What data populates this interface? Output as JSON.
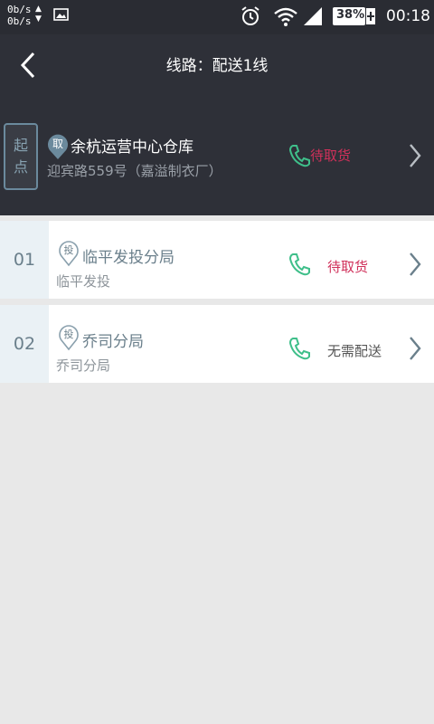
{
  "statusbar": {
    "net_up": "0b/s",
    "net_down": "0b/s",
    "battery": "38%",
    "time": "00:18",
    "icons": [
      "gallery-icon",
      "alarm-icon",
      "wifi-icon",
      "signal-icon",
      "battery-icon"
    ]
  },
  "header": {
    "title": "线路：配送1线",
    "back_icon": "chevron-left-icon"
  },
  "start": {
    "badge_line1": "起",
    "badge_line2": "点",
    "pin_label": "取",
    "name": "余杭运营中心仓库",
    "address": "迎宾路559号（嘉溢制衣厂）",
    "status": "待取货",
    "status_color": "#d0305a"
  },
  "stops": [
    {
      "index": "01",
      "pin_label": "投",
      "name": "临平发投分局",
      "sub": "临平发投",
      "status": "待取货",
      "status_color": "#d0305a"
    },
    {
      "index": "02",
      "pin_label": "投",
      "name": "乔司分局",
      "sub": "乔司分局",
      "status": "无需配送",
      "status_color": "#555555"
    }
  ],
  "colors": {
    "header_bg": "#2e3038",
    "accent_green": "#3fbf8a",
    "index_bg": "#eaf1f5"
  }
}
